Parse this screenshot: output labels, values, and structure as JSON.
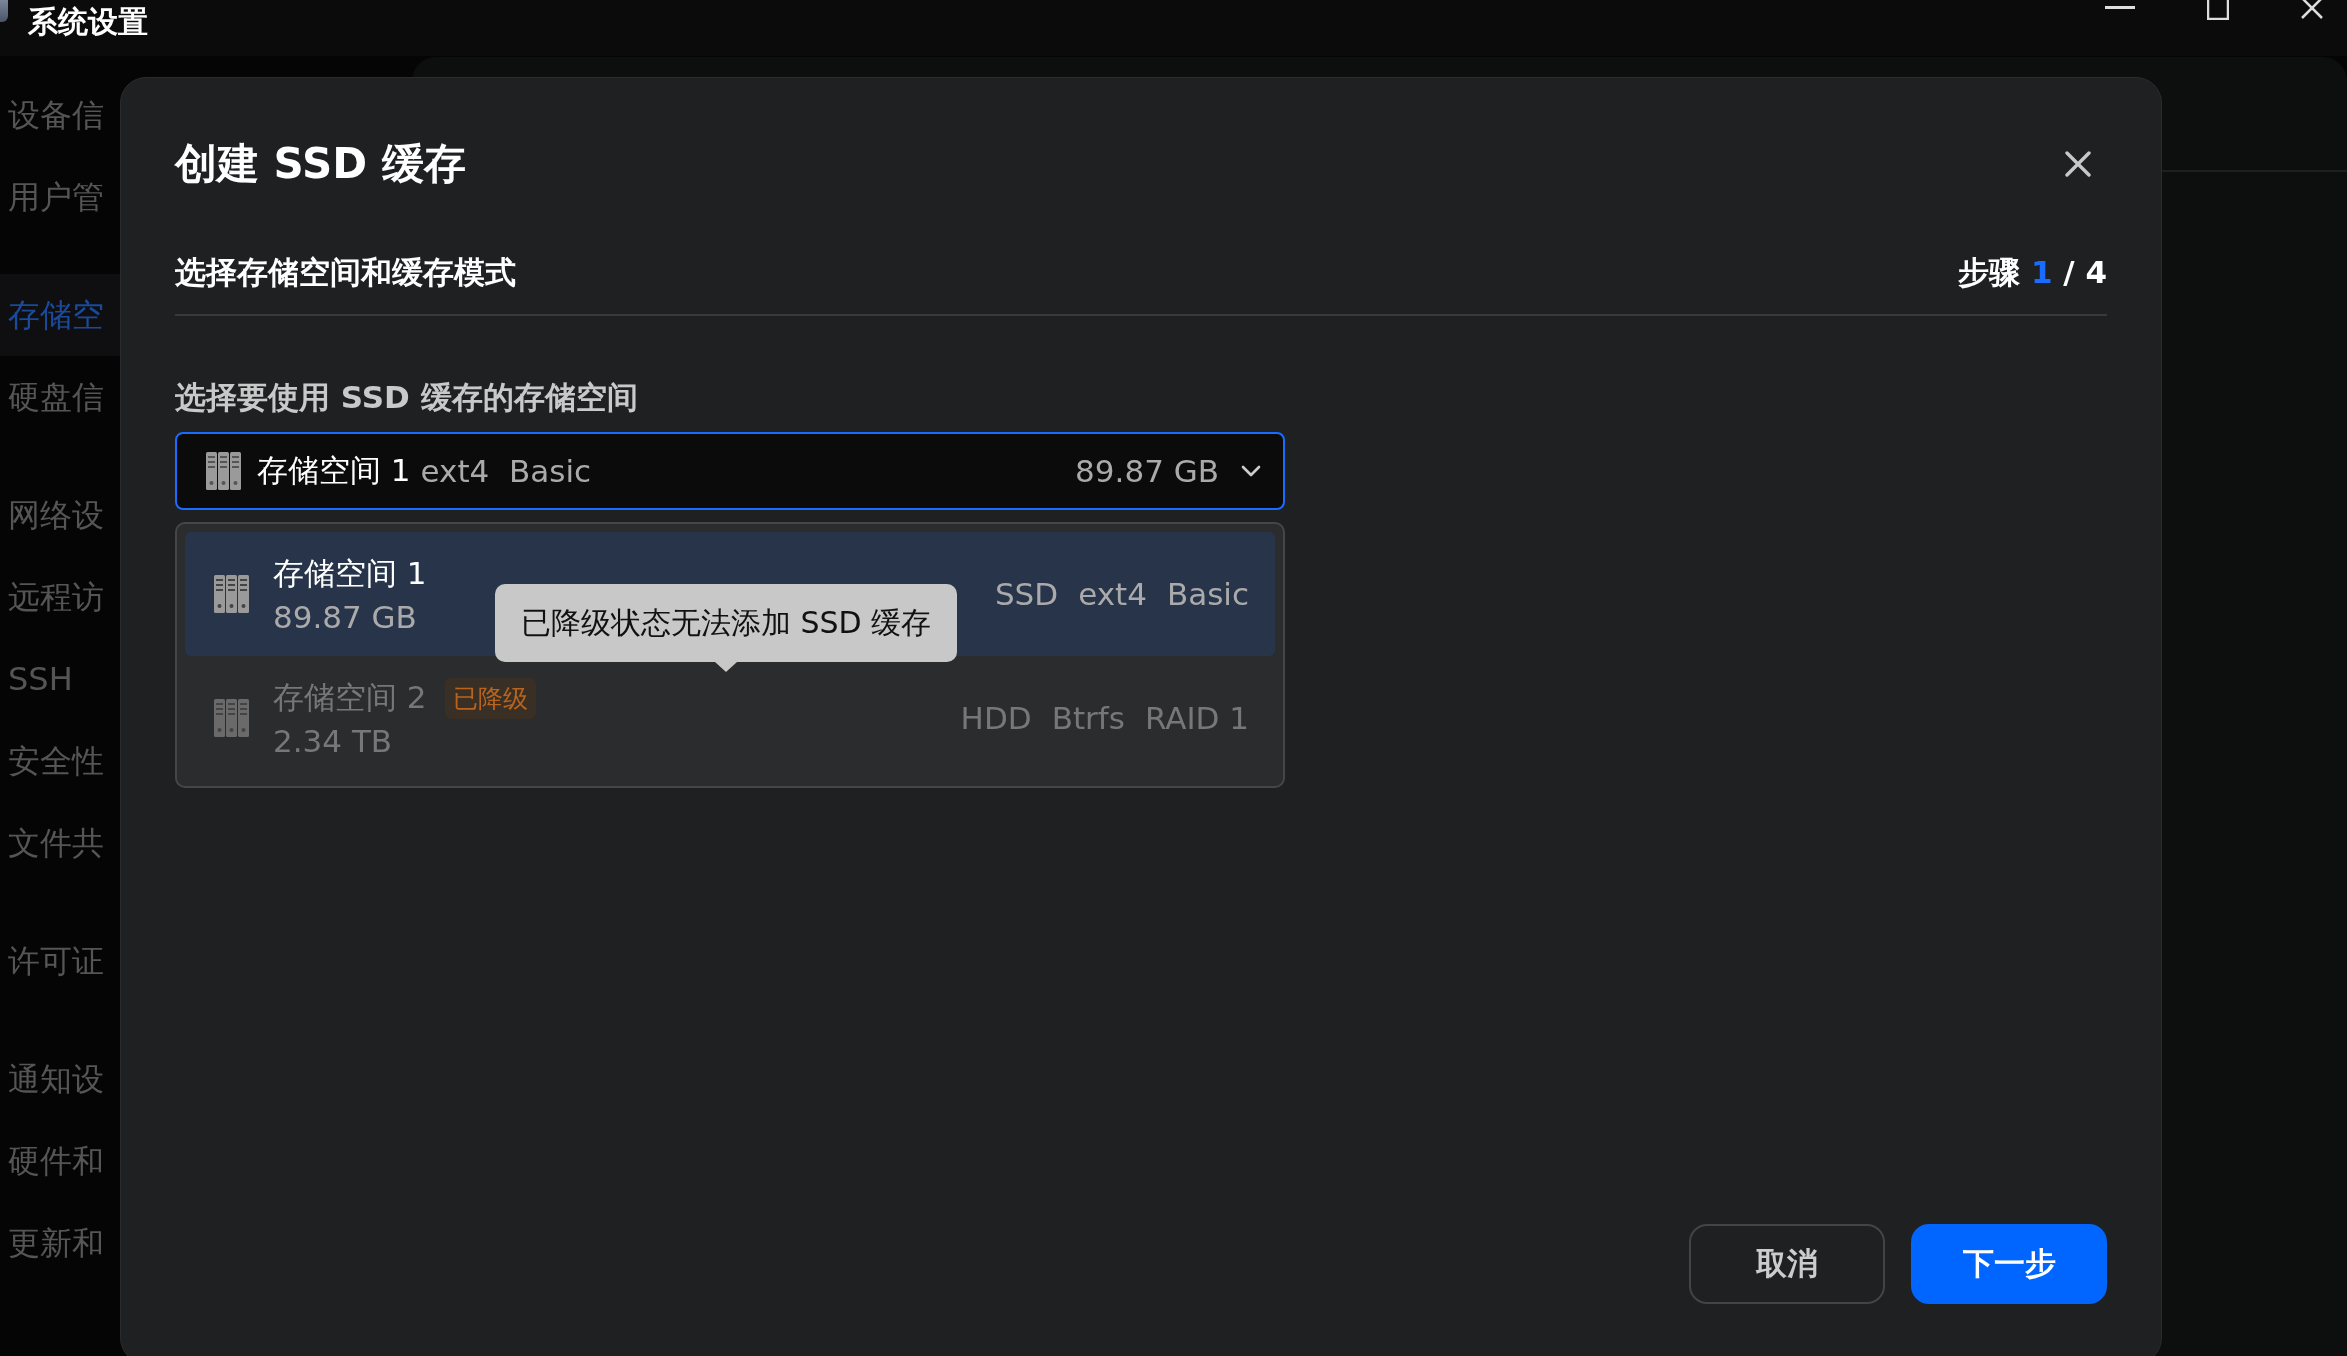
{
  "window": {
    "title": "系统设置"
  },
  "sidebar": {
    "groups": [
      {
        "items": [
          {
            "label": "设备信",
            "selected": false
          },
          {
            "label": "用户管",
            "selected": false
          }
        ]
      },
      {
        "items": [
          {
            "label": "存储空",
            "selected": true
          },
          {
            "label": "硬盘信",
            "selected": false
          }
        ]
      },
      {
        "items": [
          {
            "label": "网络设",
            "selected": false
          },
          {
            "label": "远程访",
            "selected": false
          },
          {
            "label": "SSH",
            "selected": false
          },
          {
            "label": "安全性",
            "selected": false
          },
          {
            "label": "文件共",
            "selected": false
          }
        ]
      },
      {
        "items": [
          {
            "label": "许可证",
            "selected": false
          }
        ]
      },
      {
        "items": [
          {
            "label": "通知设",
            "selected": false
          },
          {
            "label": "硬件和",
            "selected": false
          },
          {
            "label": "更新和",
            "selected": false
          }
        ]
      }
    ]
  },
  "dialog": {
    "title": "创建 SSD 缓存",
    "subtitle": "选择存储空间和缓存模式",
    "step": {
      "label": "步骤",
      "current": "1",
      "total": "/ 4"
    },
    "field_label": "选择要使用 SSD 缓存的存储空间",
    "select": {
      "name": "存储空间 1",
      "details": "ext4  Basic",
      "size": "89.87 GB",
      "expanded": true
    },
    "options": [
      {
        "name": "存储空间 1",
        "size": "89.87 GB",
        "tags": [
          "SSD",
          "ext4",
          "Basic"
        ],
        "selected": true,
        "disabled": false
      },
      {
        "name": "存储空间 2",
        "badge": "已降级",
        "size": "2.34 TB",
        "tags": [
          "HDD",
          "Btrfs",
          "RAID 1"
        ],
        "selected": false,
        "disabled": true
      }
    ],
    "tooltip": "已降级状态无法添加 SSD 缓存",
    "buttons": [
      {
        "label": "取消",
        "kind": "secondary"
      },
      {
        "label": "下一步",
        "kind": "primary"
      }
    ]
  }
}
